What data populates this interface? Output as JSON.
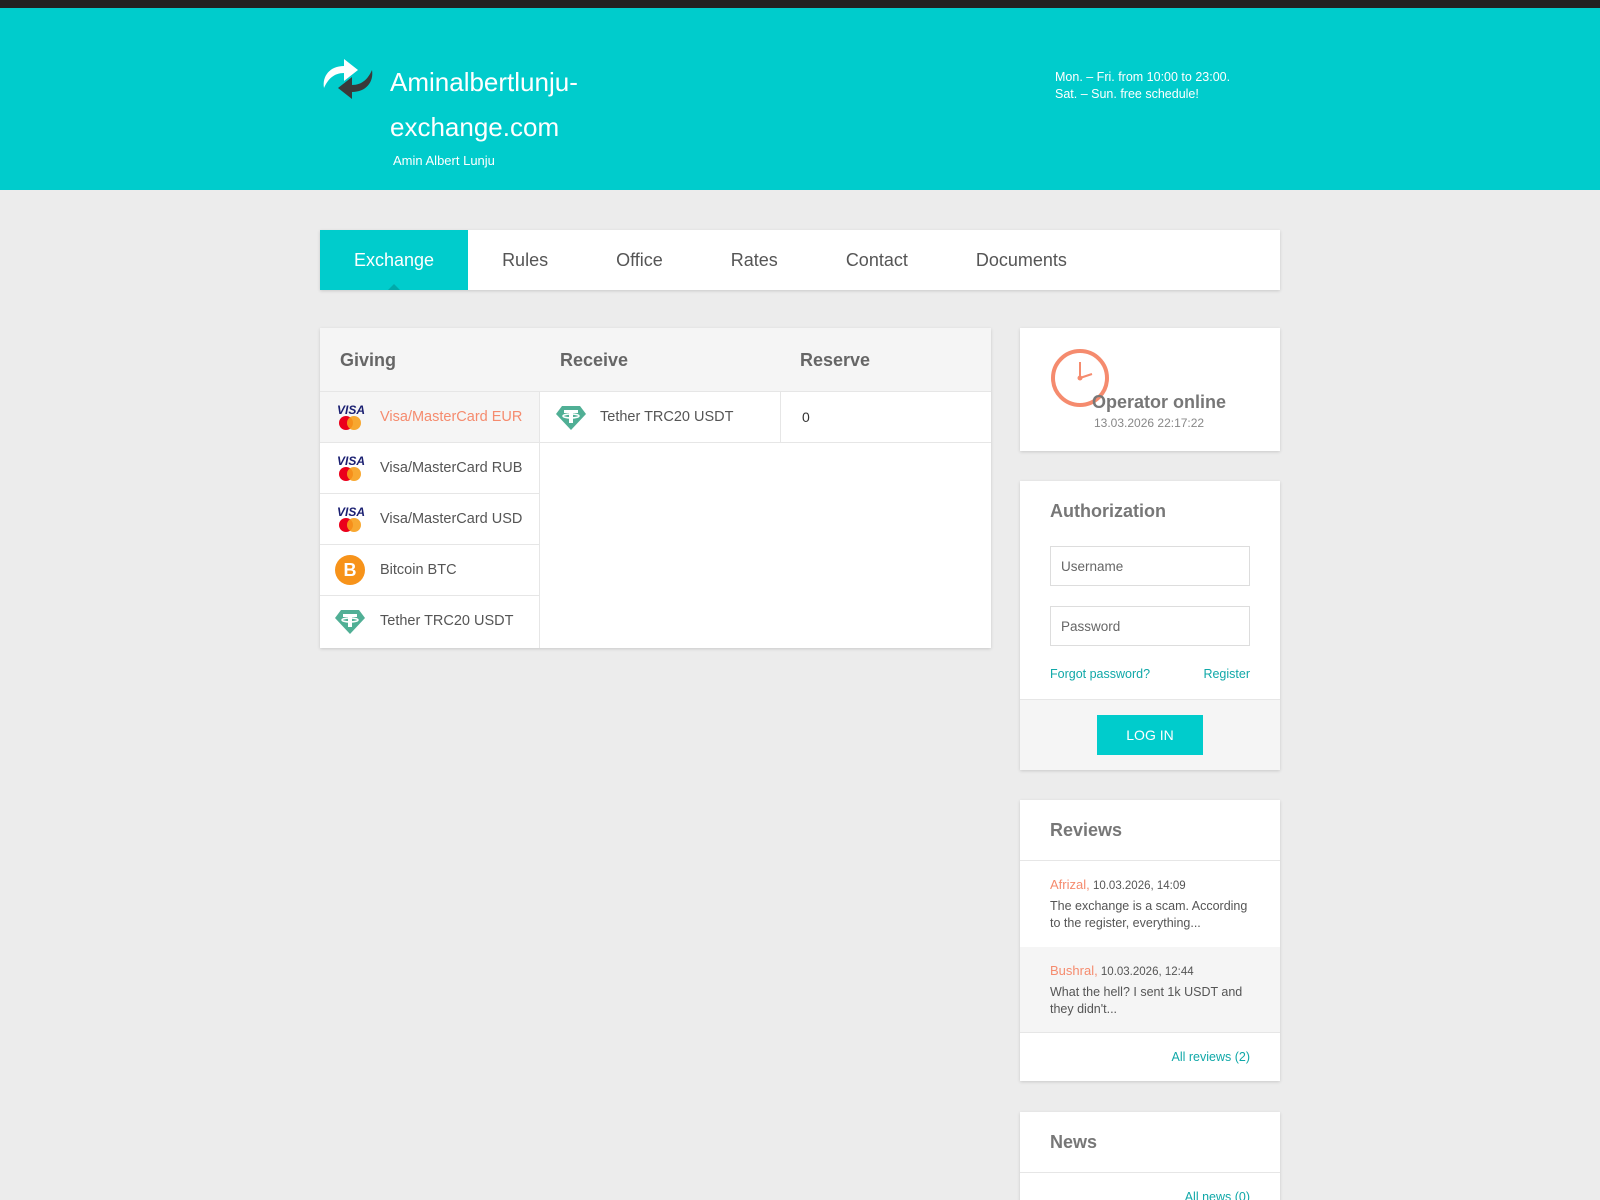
{
  "header": {
    "title": "Aminalbertlunju-exchange.com",
    "subtitle": "Amin Albert Lunju",
    "schedule_line1": "Mon. – Fri. from 10:00 to 23:00.",
    "schedule_line2": "Sat. – Sun. free schedule!"
  },
  "nav": {
    "items": [
      {
        "label": "Exchange",
        "active": true
      },
      {
        "label": "Rules"
      },
      {
        "label": "Office"
      },
      {
        "label": "Rates"
      },
      {
        "label": "Contact"
      },
      {
        "label": "Documents"
      }
    ]
  },
  "exchange": {
    "headers": {
      "giving": "Giving",
      "receive": "Receive",
      "reserve": "Reserve"
    },
    "giving": [
      {
        "label": "Visa/MasterCard EUR",
        "icon": "visa-mastercard-icon",
        "active": true
      },
      {
        "label": "Visa/MasterCard RUB",
        "icon": "visa-mastercard-icon"
      },
      {
        "label": "Visa/MasterCard USD",
        "icon": "visa-mastercard-icon"
      },
      {
        "label": "Bitcoin BTC",
        "icon": "bitcoin-icon"
      },
      {
        "label": "Tether TRC20 USDT",
        "icon": "tether-icon"
      }
    ],
    "receive": [
      {
        "label": "Tether TRC20 USDT",
        "icon": "tether-icon",
        "reserve": "0"
      }
    ]
  },
  "operator": {
    "status": "Operator online",
    "time": "13.03.2026 22:17:22",
    "icon": "clock-icon"
  },
  "auth": {
    "title": "Authorization",
    "username_placeholder": "Username",
    "password_placeholder": "Password",
    "forgot": "Forgot password?",
    "register": "Register",
    "login": "LOG IN"
  },
  "reviews": {
    "title": "Reviews",
    "items": [
      {
        "author": "Afrizal,",
        "date": "10.03.2026, 14:09",
        "text": "The exchange is a scam. According to the register, everything..."
      },
      {
        "author": "Bushral,",
        "date": "10.03.2026, 12:44",
        "text": "What the hell? I sent 1k USDT and they didn't..."
      }
    ],
    "all_link": "All reviews (2)"
  },
  "news": {
    "title": "News",
    "all_link": "All news (0)"
  },
  "colors": {
    "accent": "#00cccc",
    "highlight": "#f58b6e",
    "link": "#10a8a8"
  }
}
